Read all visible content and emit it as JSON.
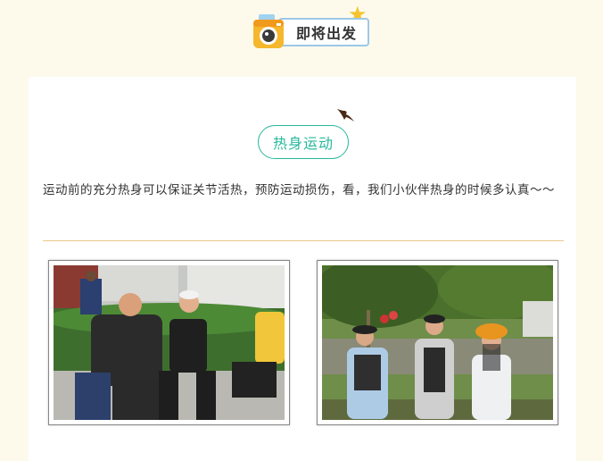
{
  "header": {
    "title": "即将出发",
    "icons": [
      "camera-icon",
      "star-icon"
    ]
  },
  "section": {
    "heading": "热身运动",
    "intro": "运动前的充分热身可以保证关节活热，预防运动损伤，看，我们小伙伴热身的时候多认真～～"
  },
  "colors": {
    "accent": "#27b89b",
    "divider": "#e8c98a",
    "background": "#fdfaec",
    "badge_border": "#9cc8e8",
    "star": "#f6c430"
  }
}
